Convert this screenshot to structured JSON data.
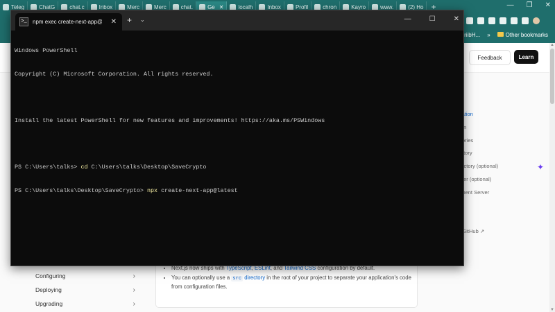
{
  "browser": {
    "tabs": [
      {
        "label": "Teleg"
      },
      {
        "label": "ChatG"
      },
      {
        "label": "chat.c"
      },
      {
        "label": "Inbox"
      },
      {
        "label": "Merc"
      },
      {
        "label": "Merc"
      },
      {
        "label": "chat."
      },
      {
        "label": "Ge",
        "active": true
      },
      {
        "label": "localh"
      },
      {
        "label": "Inbox"
      },
      {
        "label": "Profil"
      },
      {
        "label": "chron"
      },
      {
        "label": "Kayro"
      },
      {
        "label": "www."
      },
      {
        "label": "(2) Ho"
      }
    ],
    "new_tab": "+",
    "window_controls": {
      "minimize": "—",
      "maximize": "❐",
      "close": "✕"
    },
    "bookmarks": {
      "partial": "oriibH...",
      "more": "»",
      "other": "Other bookmarks"
    }
  },
  "webpage": {
    "nav": {
      "feedback": "Feedback",
      "learn": "Learn"
    },
    "toc": [
      {
        "label": "tallation",
        "active": true
      },
      {
        "label": "ation"
      },
      {
        "label": "ectories"
      },
      {
        "label": "irectory"
      },
      {
        "label": "directory (optional)"
      },
      {
        "label": "folder (optional)"
      },
      {
        "label": "opment Server"
      },
      {
        "label": ""
      },
      {
        "label": ""
      },
      {
        "label": "on GitHub ↗"
      },
      {
        "label": "↗"
      }
    ],
    "sidebar": [
      {
        "label": "Configuring",
        "chevron": "›"
      },
      {
        "label": "Deploying",
        "chevron": "›"
      },
      {
        "label": "Upgrading",
        "chevron": "›"
      }
    ],
    "note": {
      "item1": {
        "pre": "Next.js now ships with ",
        "ts": "TypeScript",
        "sep1": ", ",
        "eslint": "ESLint",
        "sep2": ", and ",
        "tailwind": "Tailwind CSS",
        "post": " configuration by default."
      },
      "item2": {
        "pre": "You can optionally use a ",
        "code": "src",
        "link": " directory",
        "post": " in the root of your project to separate your application's code from configuration files."
      }
    }
  },
  "terminal": {
    "tab_title": "npm exec create-next-app@la",
    "tab_icon": ">_",
    "new_tab": "+",
    "dropdown": "⌄",
    "controls": {
      "minimize": "—",
      "maximize": "☐",
      "close": "✕"
    },
    "lines": {
      "l1": "Windows PowerShell",
      "l2": "Copyright (C) Microsoft Corporation. All rights reserved.",
      "l3": "",
      "l4": "Install the latest PowerShell for new features and improvements! https://aka.ms/PSWindows",
      "l5": "",
      "l6_prompt": "PS C:\\Users\\talks> ",
      "l6_cmd": "cd",
      "l6_args": " C:\\Users\\talks\\Desktop\\SaveCrypto",
      "l7_prompt": "PS C:\\Users\\talks\\Desktop\\SaveCrypto> ",
      "l7_cmd": "npx",
      "l7_args": " create-next-app@latest"
    }
  },
  "colors": {
    "browser_chrome": "#1f6e6c",
    "terminal_bg": "#0c0c0c",
    "command": "#f9f1a5",
    "link": "#0a63c9"
  }
}
